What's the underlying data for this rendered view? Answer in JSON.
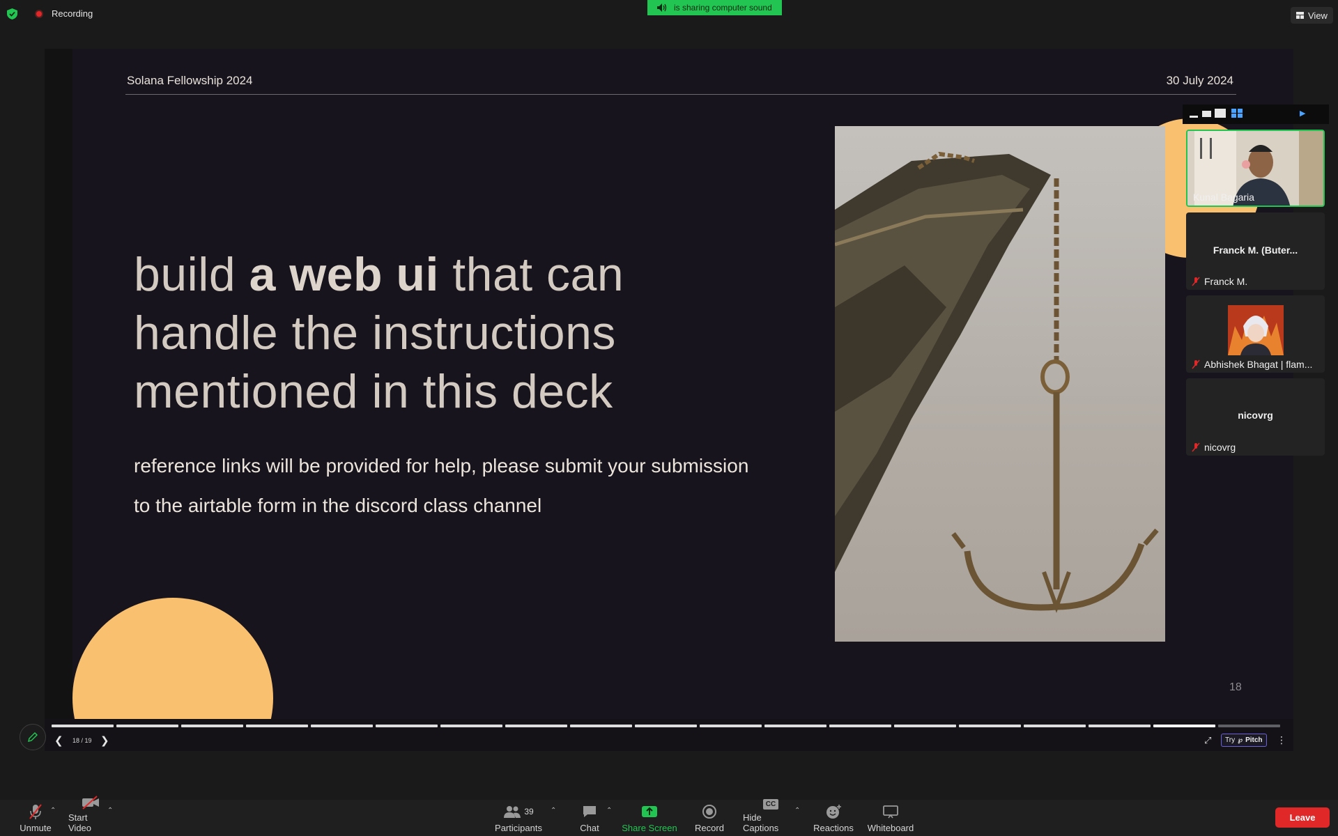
{
  "top_bar": {
    "recording_label": "Recording",
    "sound_banner": "is sharing computer sound",
    "view_label": "View"
  },
  "slide": {
    "deck_name": "Solana Fellowship 2024",
    "date": "30 July 2024",
    "headline_part1": "build ",
    "headline_bold": "a web ui",
    "headline_part2": " that can handle the instructions mentioned in this deck",
    "subtext": "reference links will be provided for help, please submit your submission to the airtable form in the discord class channel",
    "slide_number": "18",
    "accent_color": "#f8c06f",
    "background_color": "#18141d"
  },
  "pitch_bar": {
    "page_indicator": "18 / 19",
    "current_slide": 18,
    "total_slides": 19,
    "try_label": "Try",
    "pitch_label": "Pitch"
  },
  "participants_panel": {
    "tiles": [
      {
        "display_name": "Kunal Bagaria",
        "center_name": "",
        "muted": false,
        "active_speaker": true
      },
      {
        "display_name": "Franck M.",
        "center_name": "Franck M. (Buter...",
        "muted": true
      },
      {
        "display_name": "Abhishek Bhagat | flam...",
        "center_name": "",
        "muted": true
      },
      {
        "display_name": "nicovrg",
        "center_name": "nicovrg",
        "muted": true
      }
    ]
  },
  "toolbar": {
    "unmute": "Unmute",
    "start_video": "Start Video",
    "participants": "Participants",
    "participants_count": "39",
    "chat": "Chat",
    "share_screen": "Share Screen",
    "record": "Record",
    "hide_captions": "Hide Captions",
    "captions_icon_text": "CC",
    "reactions": "Reactions",
    "whiteboard": "Whiteboard",
    "leave": "Leave"
  },
  "colors": {
    "zoom_green": "#23c552",
    "leave_red": "#e02828"
  }
}
